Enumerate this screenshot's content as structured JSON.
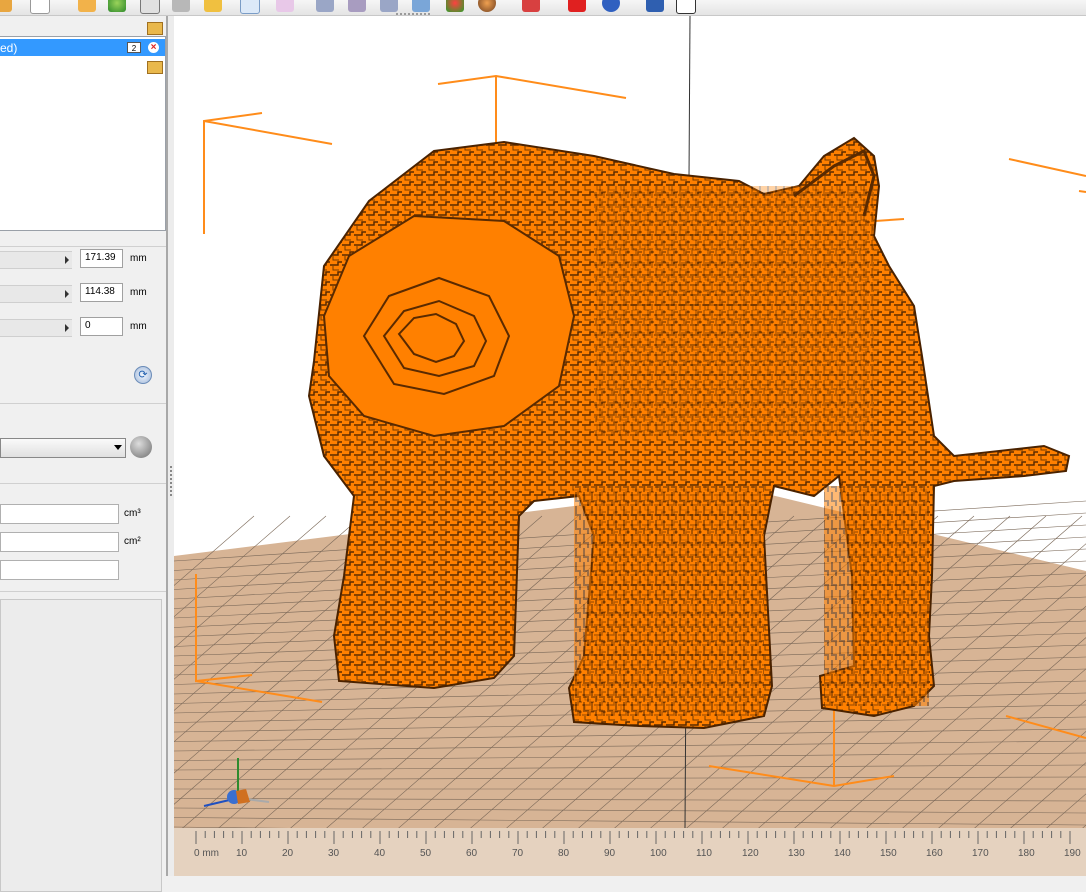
{
  "toolbar": {
    "icons": [
      "open-icon",
      "new-document-icon",
      "load-icon",
      "color-icon",
      "print-icon",
      "settings-icon",
      "search-icon",
      "select-tool-icon",
      "measure-tool-icon",
      "move-icon",
      "rotate-icon",
      "scale-icon",
      "cut-icon",
      "color-ball-icon",
      "sphere-icon",
      "undo-icon",
      "add-icon",
      "help-icon",
      "window-icon",
      "table-icon"
    ]
  },
  "object_list": {
    "selected_item_label": "ed)",
    "selected_item_count": "2"
  },
  "dimensions": {
    "x_value": "171.39",
    "y_value": "114.38",
    "z_value": "0",
    "unit": "mm"
  },
  "material": {
    "selected": ""
  },
  "properties": {
    "volume_unit": "cm³",
    "area_unit": "cm²"
  },
  "viewport": {
    "model_color": "#ff8000",
    "shadow_color": "#7a3c00",
    "bed_color": "#d7b495",
    "ruler_unit_label": "0 mm",
    "ruler_ticks": [
      "10",
      "20",
      "30",
      "40",
      "50",
      "60",
      "70",
      "80",
      "90",
      "100",
      "110",
      "120",
      "130",
      "140",
      "150",
      "160",
      "170",
      "180",
      "190"
    ]
  }
}
